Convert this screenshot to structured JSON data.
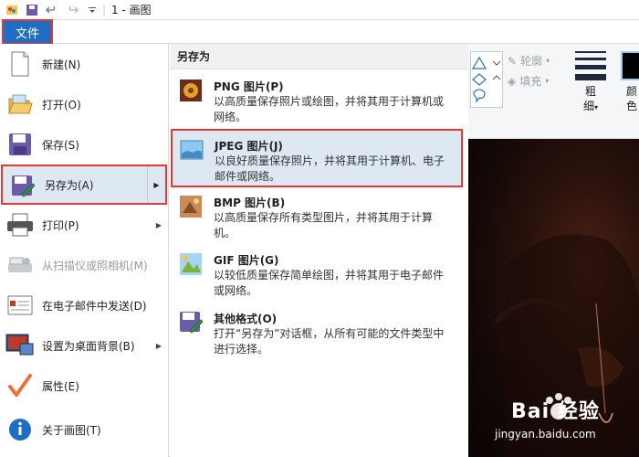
{
  "window": {
    "title": "1 - 画图"
  },
  "ribbon": {
    "file_tab": "文件",
    "outline_label": "轮廓",
    "fill_label": "填充",
    "thickness_label": "粗\n细",
    "thickness_label_1": "粗",
    "thickness_label_2": "细",
    "color_label": "颜\n色",
    "color_label_1": "颜",
    "color_label_2": "色"
  },
  "file_menu": {
    "items": [
      {
        "label": "新建(N)",
        "icon": "new-file-icon",
        "disabled": false
      },
      {
        "label": "打开(O)",
        "icon": "open-folder-icon",
        "disabled": false
      },
      {
        "label": "保存(S)",
        "icon": "save-icon",
        "disabled": false
      },
      {
        "label": "另存为(A)",
        "icon": "save-as-icon",
        "disabled": false,
        "active": true,
        "has_submenu": true
      },
      {
        "label": "打印(P)",
        "icon": "print-icon",
        "disabled": false,
        "has_submenu": true
      },
      {
        "label": "从扫描仪或照相机(M)",
        "icon": "scanner-icon",
        "disabled": true
      },
      {
        "label": "在电子邮件中发送(D)",
        "icon": "email-icon",
        "disabled": false
      },
      {
        "label": "设置为桌面背景(B)",
        "icon": "desktop-bg-icon",
        "disabled": false,
        "has_submenu": true
      },
      {
        "label": "属性(E)",
        "icon": "checkmark-icon",
        "disabled": false
      },
      {
        "label": "关于画图(T)",
        "icon": "info-icon",
        "disabled": false
      }
    ]
  },
  "save_as": {
    "header": "另存为",
    "options": [
      {
        "title": "PNG 图片(P)",
        "desc": "以高质量保存照片或绘图，并将其用于计算机或网络。",
        "icon": "png-image-icon"
      },
      {
        "title": "JPEG 图片(J)",
        "desc": "以良好质量保存照片，并将其用于计算机、电子邮件或网络。",
        "icon": "jpeg-image-icon",
        "highlighted": true
      },
      {
        "title": "BMP 图片(B)",
        "desc": "以高质量保存所有类型图片，并将其用于计算机。",
        "icon": "bmp-image-icon"
      },
      {
        "title": "GIF 图片(G)",
        "desc": "以较低质量保存简单绘图，并将其用于电子邮件或网络。",
        "icon": "gif-image-icon"
      },
      {
        "title": "其他格式(O)",
        "desc": "打开“另存为”对话框，从所有可能的文件类型中进行选择。",
        "icon": "other-formats-icon"
      }
    ]
  },
  "watermark": {
    "brand": "Bai 经验",
    "url": "jingyan.baidu.com"
  },
  "colors": {
    "accent": "#1e6fc3",
    "highlight_bg": "#dde8f3",
    "annotation_red": "#e53935"
  }
}
